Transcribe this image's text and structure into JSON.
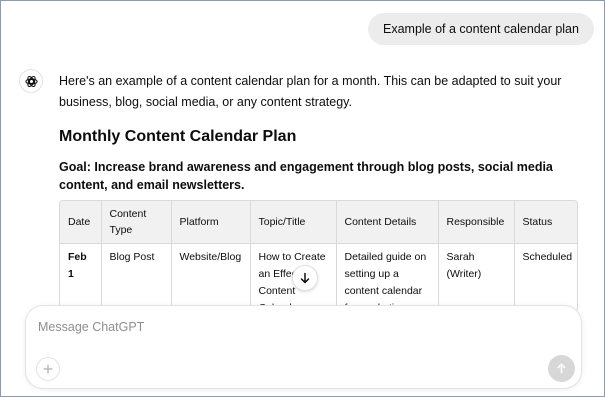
{
  "user_message": "Example of a content calendar plan",
  "assistant": {
    "avatar_icon": "openai-logo-icon",
    "intro": "Here's an example of a content calendar plan for a month. This can be adapted to suit your business, blog, social media, or any content strategy.",
    "heading": "Monthly Content Calendar Plan",
    "goal_label": "Goal",
    "goal_text": ": Increase brand awareness and engagement through blog posts, social media content, and email newsletters.",
    "table": {
      "headers": [
        "Date",
        "Content Type",
        "Platform",
        "Topic/Title",
        "Content Details",
        "Responsible",
        "Status"
      ],
      "rows": [
        [
          "Feb 1",
          "Blog Post",
          "Website/Blog",
          "How to Create an Effective Content Calendar",
          "Detailed guide on setting up a content calendar for marketing",
          "Sarah (Writer)",
          "Scheduled"
        ]
      ]
    }
  },
  "scroll_down_icon": "arrow-down-icon",
  "composer": {
    "placeholder": "Message ChatGPT",
    "value": "",
    "attach_icon": "plus-icon",
    "send_icon": "arrow-up-icon"
  },
  "colors": {
    "user_bubble": "#ececec",
    "table_header": "#f1f1f1",
    "send_disabled": "#d7d7d7",
    "frame_border": "#8a9bb4"
  }
}
